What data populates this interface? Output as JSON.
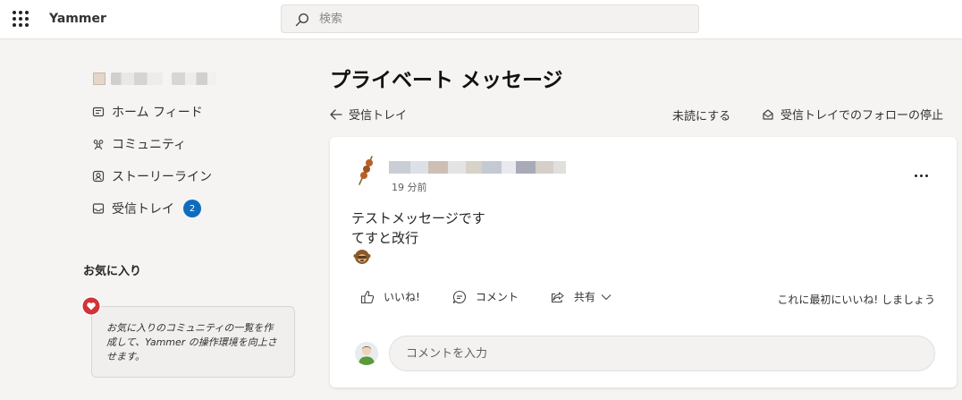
{
  "app": {
    "title": "Yammer"
  },
  "search": {
    "placeholder": "検索"
  },
  "sidebar": {
    "items": [
      {
        "label": "ホーム フィード",
        "icon": "home-feed-icon"
      },
      {
        "label": "コミュニティ",
        "icon": "community-icon"
      },
      {
        "label": "ストーリーライン",
        "icon": "storyline-icon"
      },
      {
        "label": "受信トレイ",
        "icon": "inbox-icon",
        "badge": "2"
      }
    ],
    "favorites_heading": "お気に入り",
    "favorites_hint": "お気に入りのコミュニティの一覧を作成して、Yammer の操作環境を向上させます。"
  },
  "main": {
    "title": "プライベート メッセージ",
    "back_label": "受信トレイ",
    "mark_unread_label": "未読にする",
    "unfollow_label": "受信トレイでのフォローの停止"
  },
  "message": {
    "timestamp": "19 分前",
    "lines": [
      "テストメッセージです",
      "てすと改行"
    ],
    "like_label": "いいね!",
    "comment_label": "コメント",
    "share_label": "共有",
    "be_first_label": "これに最初にいいね! しましょう",
    "comment_placeholder": "コメントを入力"
  },
  "colors": {
    "accent": "#0f6cbd",
    "heart": "#d13438"
  }
}
